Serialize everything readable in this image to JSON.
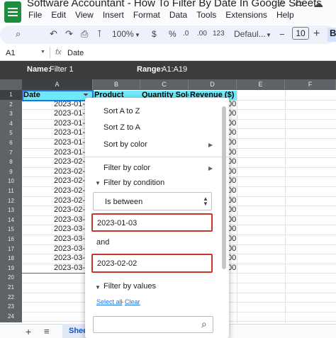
{
  "title_bar": {
    "doc_title": "Software Accountant - How To  Filter By Date In Google Sheets"
  },
  "menu": [
    "File",
    "Edit",
    "View",
    "Insert",
    "Format",
    "Data",
    "Tools",
    "Extensions",
    "Help"
  ],
  "toolbar": {
    "zoom": "100%",
    "currency": "$",
    "percent": "%",
    "decimal_decrease": ".0",
    "decimal_increase": ".00",
    "number_format": "123",
    "font": "Defaul...",
    "font_size": "10",
    "bold": "B"
  },
  "formula_bar": {
    "cell_ref": "A1",
    "fx": "fx",
    "value": "Date"
  },
  "filter_bar": {
    "name_label": "Name:",
    "name": "Filter 1",
    "range_label": "Range:",
    "range": "A1:A19"
  },
  "columns": [
    "A",
    "B",
    "C",
    "D",
    "E",
    "F"
  ],
  "rows": [
    "1",
    "2",
    "3",
    "4",
    "5",
    "6",
    "7",
    "8",
    "9",
    "10",
    "11",
    "12",
    "13",
    "14",
    "15",
    "16",
    "17",
    "18",
    "19",
    "20",
    "21",
    "22",
    "23",
    "24"
  ],
  "header_row": {
    "a": "Date",
    "b": "Product",
    "c": "Quantity Sold",
    "d": "Revenue ($)"
  },
  "date_cells": [
    "2023-01-",
    "2023-01-",
    "2023-01-",
    "2023-01-",
    "2023-01-",
    "2023-01-",
    "2023-02-",
    "2023-02-",
    "2023-02-",
    "2023-02-",
    "2023-02-",
    "2023-02-",
    "2023-03-",
    "2023-03-",
    "2023-03-",
    "2023-03-",
    "2023-03-",
    "2023-03-"
  ],
  "revenue_cells": [
    "00",
    "00",
    "00",
    "00",
    "00",
    "00",
    "00",
    "00",
    "00",
    "00",
    "00",
    "00",
    "00",
    "00",
    "00",
    "00",
    "00",
    "00"
  ],
  "filter_popup": {
    "sort_az": "Sort A to Z",
    "sort_za": "Sort Z to A",
    "sort_color": "Sort by color",
    "filter_color": "Filter by color",
    "filter_condition": "Filter by condition",
    "condition": "Is between",
    "value_from": "2023-01-03",
    "and_label": "and",
    "value_to": "2023-02-02",
    "filter_values": "Filter by values",
    "select_all": "Select all",
    "separator": "-",
    "clear": "Clear",
    "search_placeholder": ""
  },
  "bottom_bar": {
    "sheet_tab": "Shee"
  },
  "colors": {
    "header_fill": "#6fe9f9",
    "filter_bar": "#3c3c3c",
    "highlight_box": "#c5372c",
    "sheets_green": "#1e8e3e"
  }
}
